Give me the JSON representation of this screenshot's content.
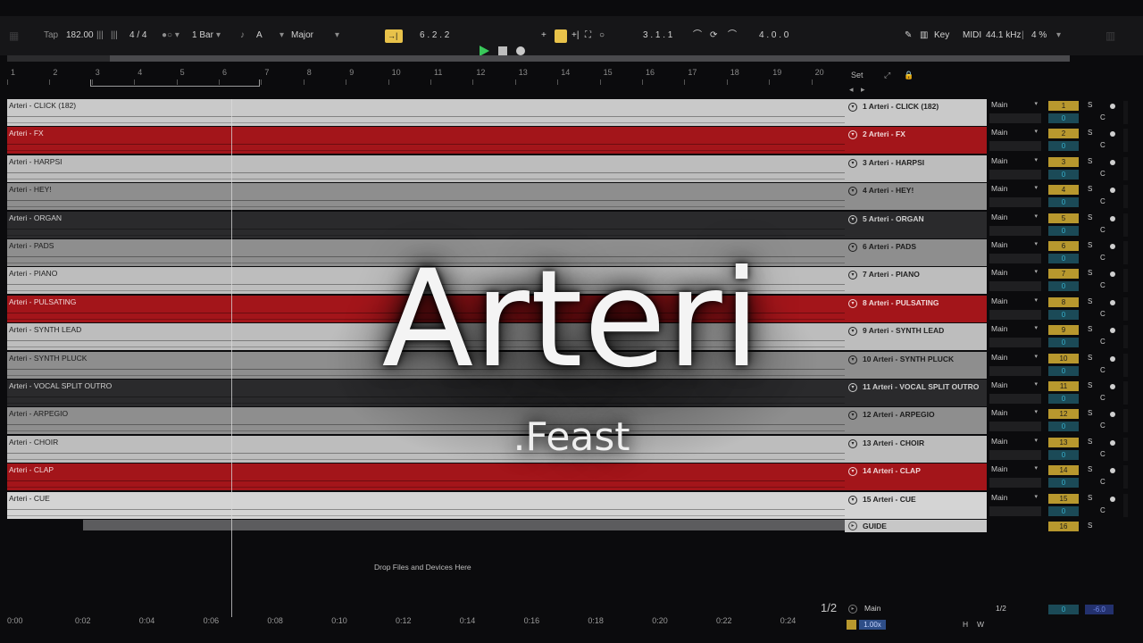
{
  "toolbar": {
    "tap_label": "Tap",
    "tempo": "182.00",
    "time_signature": "4 / 4",
    "quantize": "1 Bar",
    "key_root": "A",
    "scale": "Major",
    "arrangement_position": "6 .  2 .  2",
    "loop_start": "3 .  1 .  1",
    "loop_length": "4 .  0 .  0",
    "key_label": "Key",
    "midi_label": "MIDI",
    "sample_rate": "44.1 kHz",
    "cpu": "4 %",
    "colors": {
      "play": "#39c85a",
      "accent": "#e8c24a"
    }
  },
  "ruler": {
    "bars": [
      "1",
      "2",
      "3",
      "4",
      "5",
      "6",
      "7",
      "8",
      "9",
      "10",
      "11",
      "12",
      "13",
      "14",
      "15",
      "16",
      "17",
      "18",
      "19",
      "20"
    ],
    "set_label": "Set"
  },
  "tracks": [
    {
      "lane_name": "Arteri - CLICK (182)",
      "header": "1 Arteri - CLICK (182)",
      "num": "1",
      "color": "#c9c9c9",
      "text": "#222222"
    },
    {
      "lane_name": "Arteri - FX",
      "header": "2 Arteri - FX",
      "num": "2",
      "color": "#a3151a",
      "text": "#f0d8d8"
    },
    {
      "lane_name": "Arteri - HARPSI",
      "header": "3 Arteri - HARPSI",
      "num": "3",
      "color": "#bdbdbd",
      "text": "#222222"
    },
    {
      "lane_name": "Arteri - HEY!",
      "header": "4 Arteri - HEY!",
      "num": "4",
      "color": "#8e8e8e",
      "text": "#1c1c1c"
    },
    {
      "lane_name": "Arteri - ORGAN",
      "header": "5 Arteri - ORGAN",
      "num": "5",
      "color": "#2a2a2c",
      "text": "#cfcfcf"
    },
    {
      "lane_name": "Arteri - PADS",
      "header": "6 Arteri - PADS",
      "num": "6",
      "color": "#8e8e8e",
      "text": "#1c1c1c"
    },
    {
      "lane_name": "Arteri - PIANO",
      "header": "7 Arteri - PIANO",
      "num": "7",
      "color": "#bdbdbd",
      "text": "#222222"
    },
    {
      "lane_name": "Arteri - PULSATING",
      "header": "8 Arteri - PULSATING",
      "num": "8",
      "color": "#a3151a",
      "text": "#f0d8d8"
    },
    {
      "lane_name": "Arteri - SYNTH LEAD",
      "header": "9 Arteri - SYNTH LEAD",
      "num": "9",
      "color": "#bdbdbd",
      "text": "#222222"
    },
    {
      "lane_name": "Arteri - SYNTH PLUCK",
      "header": "10 Arteri - SYNTH PLUCK",
      "num": "10",
      "color": "#8e8e8e",
      "text": "#1c1c1c"
    },
    {
      "lane_name": "Arteri - VOCAL SPLIT OUTRO",
      "header": "11 Arteri - VOCAL SPLIT OUTRO",
      "num": "11",
      "color": "#2a2a2c",
      "text": "#cfcfcf"
    },
    {
      "lane_name": "Arteri - ARPEGIO",
      "header": "12 Arteri - ARPEGIO",
      "num": "12",
      "color": "#8e8e8e",
      "text": "#1c1c1c"
    },
    {
      "lane_name": "Arteri - CHOIR",
      "header": "13 Arteri - CHOIR",
      "num": "13",
      "color": "#bdbdbd",
      "text": "#222222"
    },
    {
      "lane_name": "Arteri - CLAP",
      "header": "14 Arteri - CLAP",
      "num": "14",
      "color": "#a3151a",
      "text": "#f0d8d8"
    },
    {
      "lane_name": "Arteri - CUE",
      "header": "15 Arteri - CUE",
      "num": "15",
      "color": "#d4d4d4",
      "text": "#222222"
    }
  ],
  "guide_track": {
    "header": "GUIDE",
    "num": "16"
  },
  "mixer": {
    "output": "Main",
    "solo": "S",
    "crossfade": "C",
    "volume": "0"
  },
  "drop_text": "Drop Files and Devices Here",
  "time_ruler": [
    "0:00",
    "0:02",
    "0:04",
    "0:06",
    "0:08",
    "0:10",
    "0:12",
    "0:14",
    "0:16",
    "0:18",
    "0:20",
    "0:22",
    "0:24"
  ],
  "footer": {
    "page": "1/2",
    "main_label": "Main",
    "half": "1/2",
    "master_volume": "0",
    "master_db": "-6.0",
    "zoom": "1.00x",
    "h_label": "H",
    "w_label": "W"
  },
  "overlay": {
    "title": "Arteri",
    "subtitle": ".Feast"
  }
}
